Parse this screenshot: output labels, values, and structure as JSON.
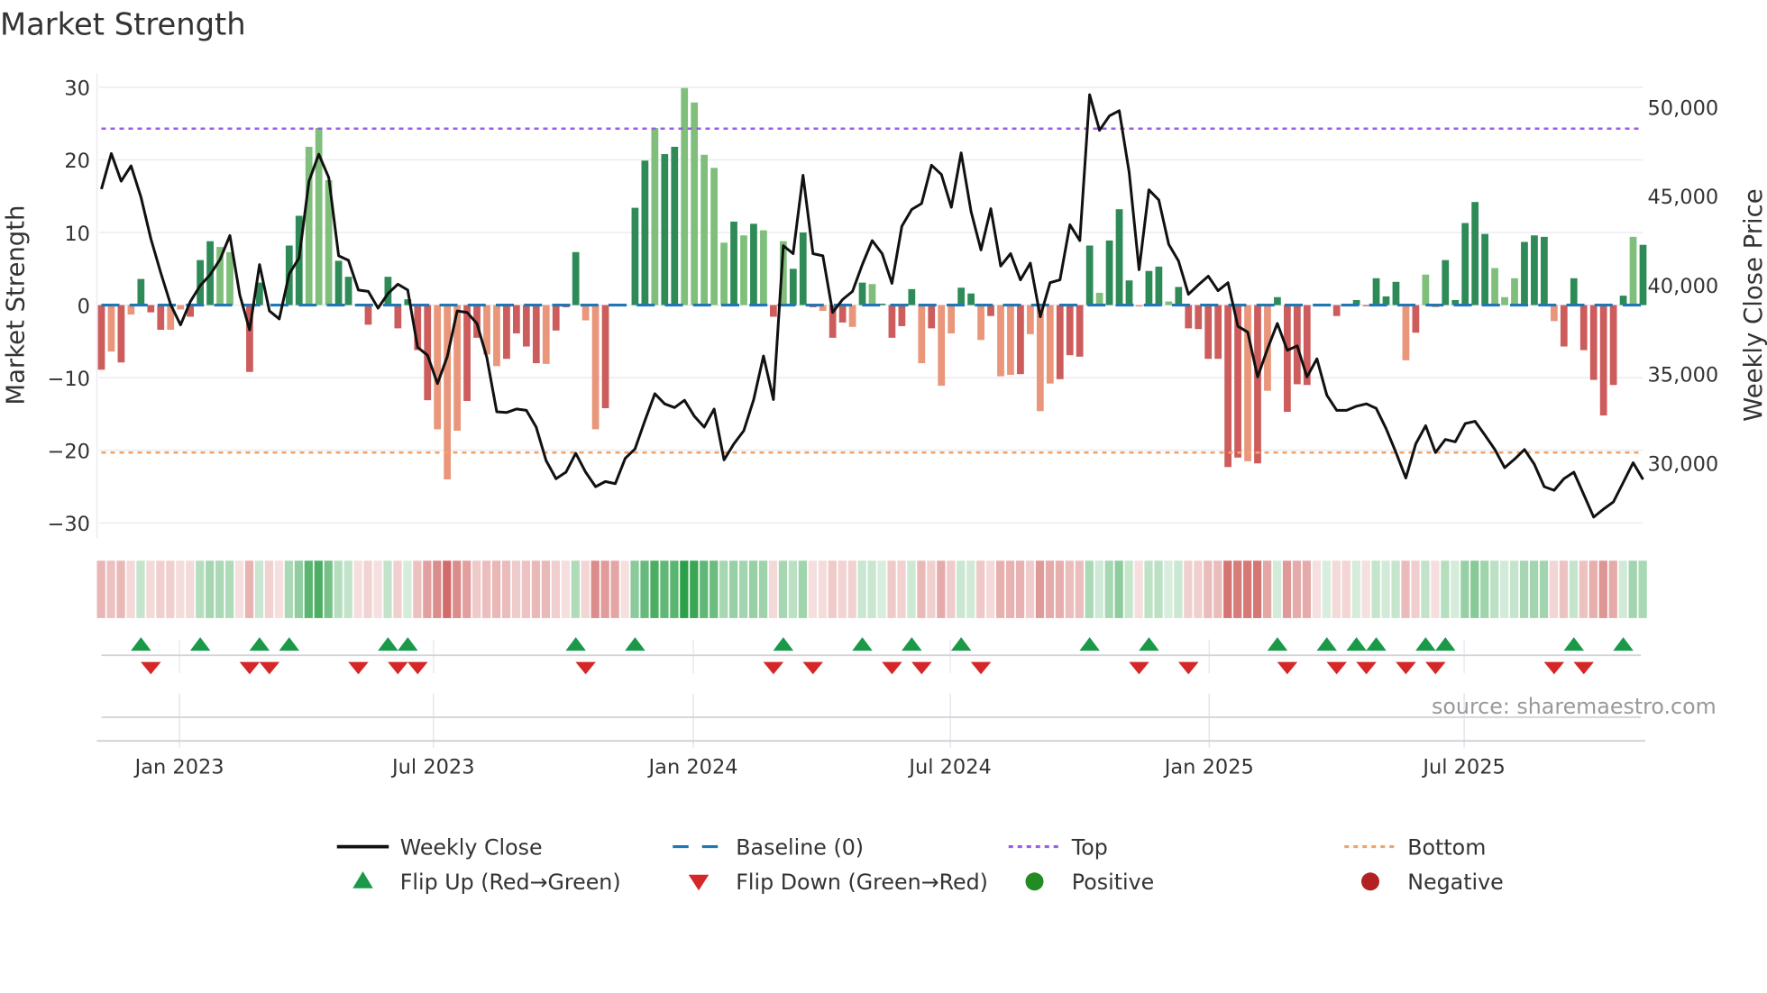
{
  "chart_data": {
    "type": "bar+line",
    "title": "Market Strength",
    "ylabel_left": "Market Strength",
    "ylabel_right": "Weekly Close Price",
    "ylim_left": [
      -32,
      32
    ],
    "yticks_left": [
      30,
      20,
      10,
      0,
      -10,
      -20,
      -30
    ],
    "ytick_labels_left": [
      "30",
      "20",
      "10",
      "0",
      "−10",
      "−20",
      "−30"
    ],
    "ylim_right": [
      26500,
      52200
    ],
    "yticks_right": [
      50000,
      45000,
      40000,
      35000,
      30000
    ],
    "ytick_labels_right": [
      "50,000",
      "45,000",
      "40,000",
      "35,000",
      "30,000"
    ],
    "x_ticks": [
      {
        "label": "Jan 2023",
        "week": 7.9
      },
      {
        "label": "Jul 2023",
        "week": 33.6
      },
      {
        "label": "Jan 2024",
        "week": 59.9
      },
      {
        "label": "Jul 2024",
        "week": 85.9
      },
      {
        "label": "Jan 2025",
        "week": 112.1
      },
      {
        "label": "Jul 2025",
        "week": 137.9
      }
    ],
    "top_level": 24.3,
    "bottom_level": -20.3,
    "baseline": 0,
    "strength": [
      -8.9,
      -6.4,
      -7.9,
      -1.3,
      3.6,
      -1.0,
      -3.4,
      -3.4,
      -0.6,
      -1.6,
      6.2,
      8.8,
      8.0,
      7.3,
      0,
      -9.2,
      3.1,
      -3.0,
      0,
      8.2,
      12.3,
      21.8,
      24.4,
      17.2,
      6.1,
      3.9,
      -0.5,
      -2.7,
      0,
      3.9,
      -3.2,
      0.8,
      -6.2,
      -13.1,
      -17.1,
      -24.0,
      -17.3,
      -13.2,
      -4.5,
      -6.8,
      -8.4,
      -7.4,
      -3.9,
      -5.7,
      -8.0,
      -8.1,
      -3.5,
      -0.3,
      7.3,
      -2.1,
      -17.1,
      -14.2,
      -12.0,
      0,
      13.4,
      19.9,
      24.4,
      20.8,
      21.8,
      29.9,
      27.9,
      20.7,
      18.9,
      8.6,
      11.5,
      9.6,
      11.2,
      10.3,
      -1.6,
      8.8,
      5.0,
      10.0,
      -0.3,
      -0.8,
      -4.5,
      -2.4,
      -3.0,
      3.1,
      2.9,
      0.2,
      -4.5,
      -2.9,
      2.2,
      -8.0,
      -3.2,
      -11.1,
      -3.9,
      2.4,
      1.6,
      -4.8,
      -1.5,
      -9.8,
      -9.6,
      -9.5,
      -4.0,
      -14.6,
      -10.8,
      -10.2,
      -6.9,
      -7.1,
      8.2,
      1.7,
      8.9,
      13.2,
      3.4,
      -0.2,
      4.7,
      5.3,
      0.5,
      2.5,
      -3.2,
      -3.3,
      -7.4,
      -7.4,
      -22.3,
      -21.0,
      -21.5,
      -21.8,
      -11.8,
      1.1,
      -14.7,
      -10.9,
      -11.0,
      0,
      0.2,
      -1.5,
      -2.2,
      0.7,
      -0.1,
      3.7,
      1.2,
      3.2,
      -7.6,
      -3.8,
      4.2,
      -0.3,
      6.2,
      0.7,
      11.3,
      14.2,
      9.8,
      5.1,
      1.1,
      3.7,
      8.7,
      9.6,
      9.4,
      -2.2,
      -5.7,
      3.7,
      -6.2,
      -10.3,
      -15.2,
      -11.0,
      1.3,
      9.4,
      8.3
    ],
    "shade": "dldldddlldddllxddxdddlllddxdddddddlllddllddddldddlldxdddlddllllldldldldddlddldlddddldllddldlldlllddddldddlddldddddddldlddddlldxdddddldlldddddllldddldddddddl",
    "weekly_close": [
      45380,
      47380,
      45830,
      46690,
      44930,
      42610,
      40690,
      38900,
      37750,
      39060,
      39960,
      40570,
      41420,
      42770,
      39430,
      37470,
      41140,
      38530,
      38080,
      40610,
      41510,
      45830,
      47340,
      46040,
      41630,
      41380,
      39710,
      39630,
      38690,
      39510,
      40040,
      39710,
      36490,
      36040,
      34450,
      35960,
      38530,
      38450,
      37830,
      35920,
      32860,
      32820,
      33020,
      32940,
      32000,
      30120,
      29100,
      29470,
      30530,
      29470,
      28650,
      28940,
      28820,
      30250,
      30780,
      32370,
      33880,
      33310,
      33100,
      33510,
      32610,
      32000,
      33020,
      30160,
      31060,
      31800,
      33550,
      36000,
      33550,
      42200,
      41750,
      46160,
      41750,
      41630,
      38450,
      39180,
      39630,
      41140,
      42490,
      41750,
      40080,
      43300,
      44240,
      44570,
      46730,
      46200,
      44360,
      47420,
      44120,
      41960,
      44280,
      41060,
      41750,
      40280,
      41220,
      38200,
      40120,
      40280,
      43380,
      42490,
      50690,
      48690,
      49500,
      49790,
      46320,
      40850,
      45340,
      44770,
      42280,
      41340,
      39470,
      40000,
      40490,
      39670,
      40120,
      37670,
      37340,
      34820,
      36410,
      37830,
      36320,
      36570,
      34820,
      35840,
      33800,
      32940,
      32940,
      33180,
      33310,
      33060,
      31920,
      30570,
      29140,
      31060,
      32080,
      30570,
      31310,
      31180,
      32200,
      32330,
      31550,
      30740,
      29720,
      30200,
      30740,
      29920,
      28650,
      28450,
      29100,
      29470,
      28210,
      26940,
      27390,
      27800,
      28900,
      30000,
      29060
    ],
    "legend": [
      {
        "key": "weekly_close",
        "label": "Weekly Close"
      },
      {
        "key": "baseline",
        "label": "Baseline (0)"
      },
      {
        "key": "top",
        "label": "Top"
      },
      {
        "key": "bottom",
        "label": "Bottom"
      },
      {
        "key": "flip_up",
        "label": "Flip Up (Red→Green)"
      },
      {
        "key": "flip_down",
        "label": "Flip Down (Green→Red)"
      },
      {
        "key": "positive",
        "label": "Positive"
      },
      {
        "key": "negative",
        "label": "Negative"
      }
    ],
    "legend_position": "bottom",
    "grid": true,
    "source": "source: sharemaestro.com",
    "colors": {
      "pos_dark": "#2e8b57",
      "pos_light": "#7fbf7b",
      "neg_dark": "#cd5c5c",
      "neg_light": "#e9967a",
      "line": "#111111",
      "baseline": "#1f77b4",
      "top": "#9b5de5",
      "bottom": "#f4a261",
      "flip_up": "#1a9a48",
      "flip_down": "#d62728",
      "positive": "#228b22",
      "negative": "#b22222",
      "strip_pos": "#2ca048",
      "strip_neg": "#c8504d"
    }
  }
}
